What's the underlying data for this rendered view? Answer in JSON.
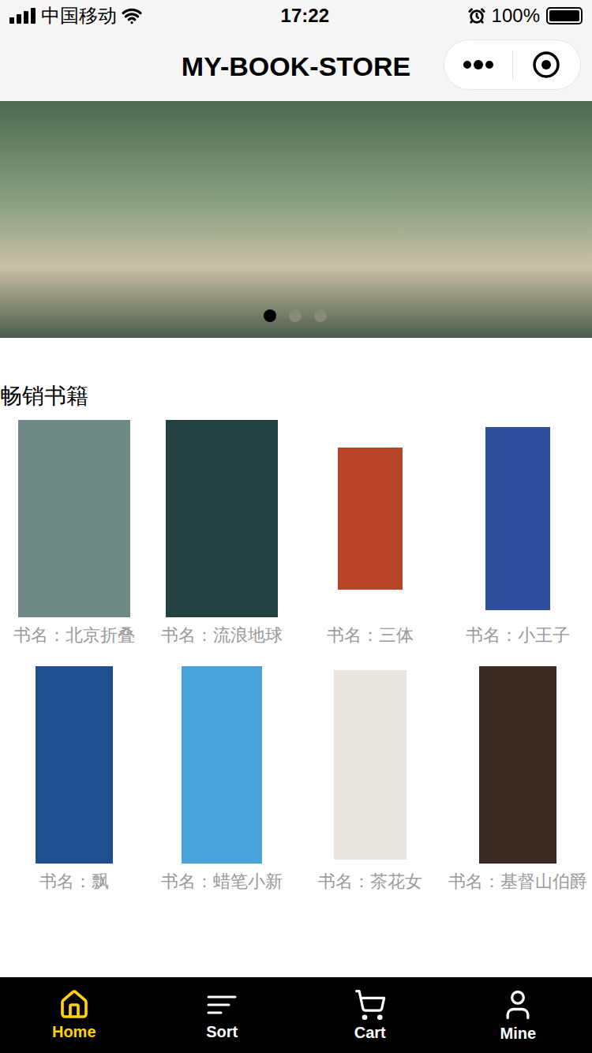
{
  "status_bar": {
    "carrier": "中国移动",
    "time": "17:22",
    "battery": "100%",
    "battery_level": 1
  },
  "nav_bar": {
    "title": "MY-BOOK-STORE"
  },
  "banner": {
    "dots": [
      {
        "selected": true
      },
      {
        "selected": false
      },
      {
        "selected": false
      }
    ]
  },
  "section": {
    "title": "畅销书籍"
  },
  "books": [
    {
      "title": "书名：北京折叠"
    },
    {
      "title": "书名：流浪地球"
    },
    {
      "title": "书名：三体"
    },
    {
      "title": "书名：小王子"
    },
    {
      "title": "书名：飘"
    },
    {
      "title": "书名：蜡笔小新"
    },
    {
      "title": "书名：茶花女"
    },
    {
      "title": "书名：基督山伯爵"
    }
  ],
  "tab_bar": [
    {
      "label": "Home",
      "selected": true
    },
    {
      "label": "Sort",
      "selected": false
    },
    {
      "label": "Cart",
      "selected": false
    },
    {
      "label": "Mine",
      "selected": false
    }
  ]
}
